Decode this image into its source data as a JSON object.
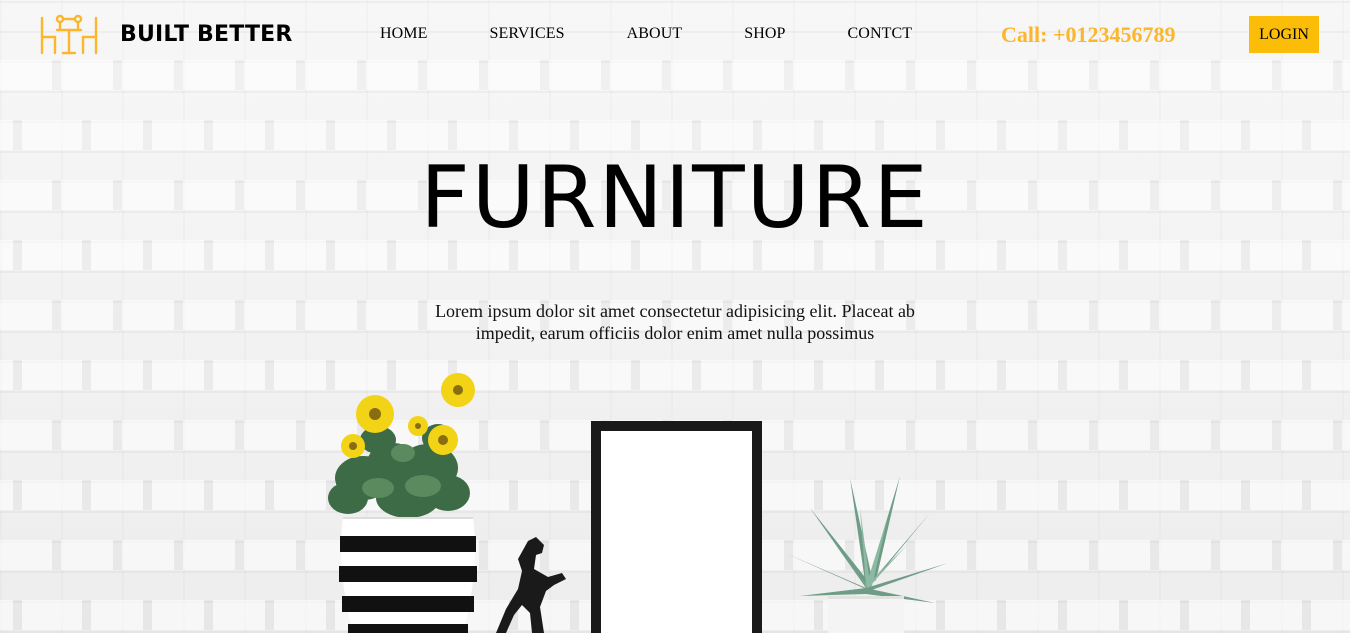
{
  "header": {
    "brand": "BUILT BETTER",
    "nav": [
      "HOME",
      "SERVICES",
      "ABOUT",
      "SHOP",
      "CONTCT"
    ],
    "phone": "Call: +0123456789",
    "login_label": "LOGIN"
  },
  "hero": {
    "title": "FURNITURE",
    "text": "Lorem ipsum dolor sit amet consectetur adipisicing elit. Placeat ab impedit, earum officiis dolor enim amet nulla possimus"
  },
  "colors": {
    "accent": "#fbb62c",
    "button": "#fbbd08"
  },
  "icons": {
    "logo": "furniture-table-chairs-icon"
  }
}
